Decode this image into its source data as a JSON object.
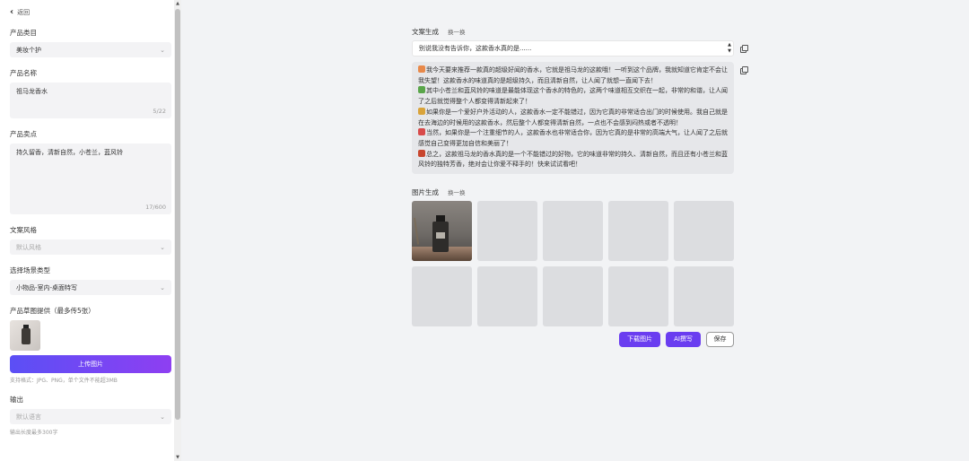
{
  "sidebar": {
    "back_label": "返回",
    "category": {
      "label": "产品类目",
      "value": "美妆个护"
    },
    "name": {
      "label": "产品名称",
      "value": "祖马龙香水",
      "count": "5/22"
    },
    "selling": {
      "label": "产品卖点",
      "value": "持久留香，清新自然，小苍兰，蓝风铃",
      "count": "17/600"
    },
    "style": {
      "label": "文案风格",
      "placeholder": "默认风格"
    },
    "scene": {
      "label": "选择场景类型",
      "value": "小物品-室内-桌面特写"
    },
    "image": {
      "label": "产品草图提供（最多传5张）",
      "upload_label": "上传图片",
      "hint": "支持格式：JPG、PNG，单个文件不能超3MB"
    },
    "output": {
      "label": "输出",
      "placeholder": "默认语言",
      "hint": "输出长度最多300字"
    }
  },
  "copy_section": {
    "title": "文案生成",
    "switch_label": "换一换",
    "input_value": "别说我没有告诉你，这款香水真的是......",
    "paragraphs": [
      {
        "icon": "emoji-face-icon",
        "color": "#e8894a",
        "text": "我今天要来推荐一款真的超级好闻的香水，它就是祖马龙的这款哦！一听到这个品牌，我就知道它肯定不会让我失望！这款香水的味道真的是超级持久，而且清新自然，让人闻了就想一直闻下去！"
      },
      {
        "icon": "emoji-flower-icon",
        "color": "#5aa64a",
        "text": "其中小苍兰和蓝风铃的味道是最能体现这个香水的特色的，这两个味道相互交织在一起，非常的和谐，让人闻了之后就觉得整个人都变得清新起来了！"
      },
      {
        "icon": "emoji-memo-icon",
        "color": "#d9a33a",
        "text": "如果你是一个爱好户外活动的人，这款香水一定不能错过，因为它真的非常适合出门的时候使用。我自己就是在去海边的时候用的这款香水，然后整个人都变得清新自然，一点也不会感到闷热或者不透明！"
      },
      {
        "icon": "emoji-person-icon",
        "color": "#d84a4a",
        "text": "当然，如果你是一个注重细节的人，这款香水也非常适合你，因为它真的是非常的高端大气，让人闻了之后就感觉自己变得更加自信和美丽了！"
      },
      {
        "icon": "emoji-person-icon",
        "color": "#c8462e",
        "text": "总之，这款祖马龙的香水真的是一个不能错过的好物，它的味道非常的持久、清新自然，而且还有小苍兰和蓝风铃的独特芳香，绝对会让你爱不释手的！快来试试看吧！"
      }
    ]
  },
  "image_section": {
    "title": "图片生成",
    "switch_label": "换一换",
    "cells": [
      "photo",
      "empty",
      "empty",
      "empty",
      "empty",
      "empty",
      "empty",
      "empty",
      "empty",
      "empty"
    ]
  },
  "actions": {
    "download": "下载图片",
    "ai": "AI撰写",
    "save": "保存"
  }
}
